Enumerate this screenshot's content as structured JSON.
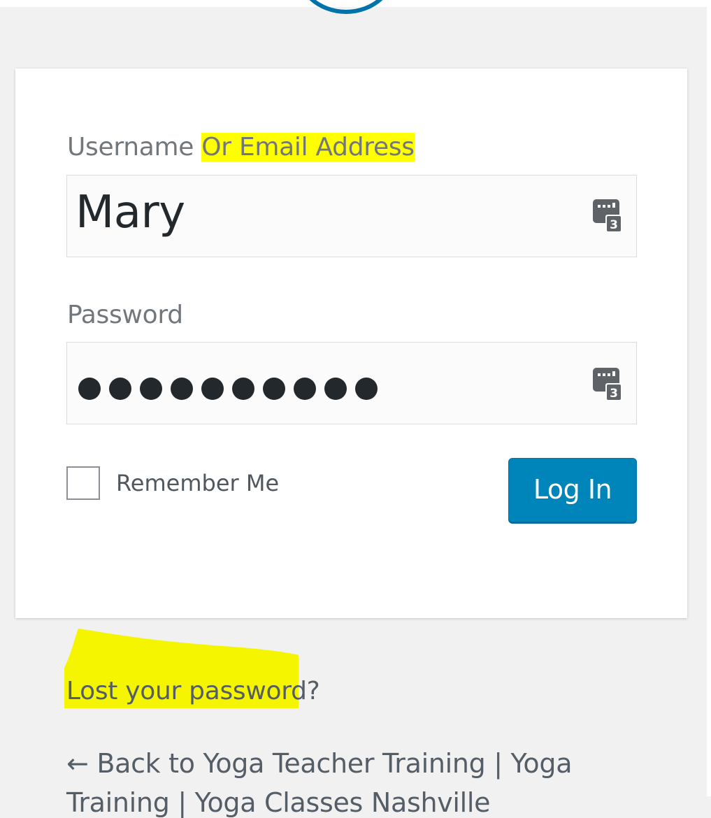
{
  "form": {
    "username_label_plain": "Username ",
    "username_label_highlight": "Or Email Address",
    "username_value": "Mary",
    "password_label": "Password",
    "password_dot_count": 10,
    "password_manager_badge": "3",
    "remember_label": "Remember Me",
    "remember_checked": false,
    "login_button": "Log In"
  },
  "links": {
    "lost_password_highlight": "Lost your password",
    "lost_password_suffix": "?",
    "back_line_1": "← Back to Yoga Teacher Training | Yoga",
    "back_line_2": "Training | Yoga Classes Nashville"
  },
  "colors": {
    "background": "#f1f1f1",
    "button": "#0085ba",
    "highlight": "#ffff00",
    "label": "#72777c"
  },
  "icons": {
    "password_manager": "password-manager-icon",
    "logo": "wordpress-logo-icon"
  }
}
